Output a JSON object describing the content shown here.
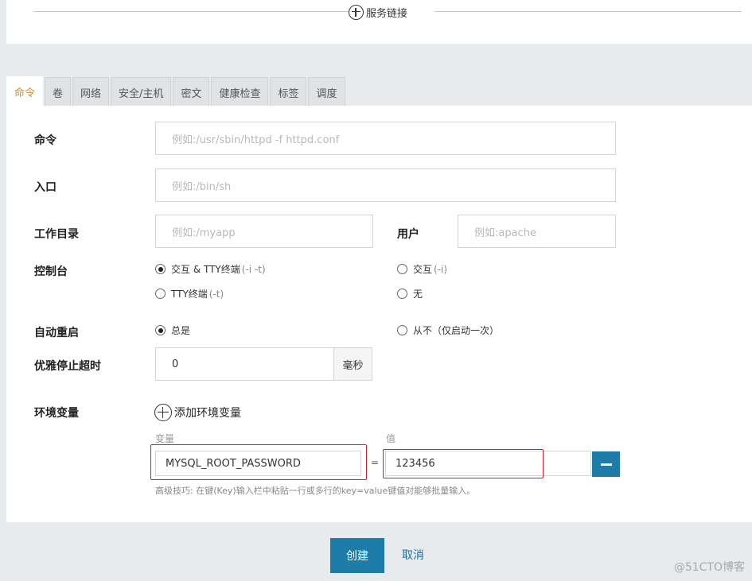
{
  "service_link": {
    "label": "服务链接"
  },
  "tabs": [
    {
      "label": "命令",
      "active": true
    },
    {
      "label": "卷"
    },
    {
      "label": "网络"
    },
    {
      "label": "安全/主机"
    },
    {
      "label": "密文"
    },
    {
      "label": "健康检查"
    },
    {
      "label": "标签"
    },
    {
      "label": "调度"
    }
  ],
  "form": {
    "command": {
      "label": "命令",
      "placeholder": "例如:/usr/sbin/httpd -f httpd.conf"
    },
    "entrypoint": {
      "label": "入口",
      "placeholder": "例如:/bin/sh"
    },
    "workdir": {
      "label": "工作目录",
      "placeholder": "例如:/myapp"
    },
    "user": {
      "label": "用户",
      "placeholder": "例如:apache"
    },
    "console": {
      "label": "控制台",
      "options": [
        {
          "label": "交互 & TTY终端",
          "hint": "(-i -t)",
          "selected": true
        },
        {
          "label": "交互",
          "hint": "(-i)",
          "selected": false
        },
        {
          "label": "TTY终端",
          "hint": "(-t)",
          "selected": false
        },
        {
          "label": "无",
          "hint": "",
          "selected": false
        }
      ]
    },
    "restart": {
      "label": "自动重启",
      "options": [
        {
          "label": "总是",
          "selected": true
        },
        {
          "label": "从不（仅启动一次）",
          "selected": false
        }
      ]
    },
    "stop_timeout": {
      "label": "优雅停止超时",
      "value": "0",
      "unit": "毫秒"
    },
    "env": {
      "label": "环境变量",
      "add_label": "添加环境变量",
      "key_header": "变量",
      "value_header": "值",
      "equals": "=",
      "rows": [
        {
          "key": "MYSQL_ROOT_PASSWORD",
          "value": "123456"
        }
      ],
      "tip": "高级技巧: 在键(Key)输入栏中粘贴一行或多行的key=value键值对能够批量输入。"
    }
  },
  "actions": {
    "create": "创建",
    "cancel": "取消"
  },
  "watermark": "@51CTO博客",
  "colors": {
    "primary": "#1e7ca8",
    "active_tab": "#d58b2b",
    "highlight_box": "#c8262b"
  }
}
